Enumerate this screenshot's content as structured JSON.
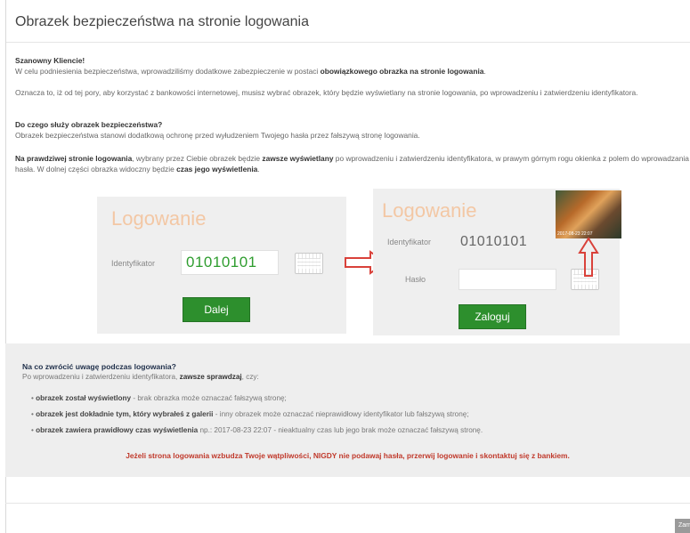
{
  "modal": {
    "title": "Obrazek bezpieczeństwa na stronie logowania",
    "greeting": "Szanowny Kliencie!",
    "intro_prefix": "W celu podniesienia bezpieczeństwa, wprowadziliśmy dodatkowe zabezpieczenie w postaci ",
    "intro_bold": "obowiązkowego obrazka na stronie logowania",
    "intro_suffix": ".",
    "paragraph2": "Oznacza to, iż od tej pory, aby korzystać z bankowości internetowej, musisz wybrać obrazek, który będzie wyświetlany na stronie logowania, po wprowadzeniu i zatwierdzeniu identyfikatora.",
    "question": "Do czego służy obrazek bezpieczeństwa?",
    "answer": "Obrazek bezpieczeństwa stanowi dodatkową ochronę przed wyłudzeniem Twojego hasła przez fałszywą stronę logowania.",
    "p4_bold1": "Na prawdziwej stronie logowania",
    "p4_text1": ", wybrany przez Ciebie obrazek będzie ",
    "p4_bold2": "zawsze wyświetlany",
    "p4_text2": " po wprowadzeniu i zatwierdzeniu identyfikatora, w prawym górnym rogu okienka z polem do wprowadzania hasła. W dolnej części obrazka widoczny będzie ",
    "p4_bold3": "czas jego wyświetlenia",
    "p4_text3": "."
  },
  "login1": {
    "title": "Logowanie",
    "id_label": "Identyfikator",
    "id_value": "01010101",
    "button": "Dalej"
  },
  "login2": {
    "title": "Logowanie",
    "id_label": "Identyfikator",
    "id_value": "01010101",
    "password_label": "Hasło",
    "button": "Zaloguj",
    "image_timestamp": "2017-08-23 22:07"
  },
  "tips": {
    "heading": "Na co zwrócić uwagę podczas logowania?",
    "sub_prefix": "Po wprowadzeniu i zatwierdzeniu identyfikatora, ",
    "sub_bold": "zawsze sprawdzaj",
    "sub_suffix": ", czy:",
    "b1_bold": "obrazek został wyświetlony",
    "b1_text": " - brak obrazka może oznaczać fałszywą stronę;",
    "b2_bold": "obrazek jest dokładnie tym, który wybrałeś z galerii",
    "b2_text": " - inny obrazek może oznaczać nieprawidłowy identyfikator lub fałszywą stronę;",
    "b3_bold": "obrazek zawiera prawidłowy czas wyświetlenia",
    "b3_text": " np.: 2017-08-23 22:07 - nieaktualny czas lub jego brak może oznaczać fałszywą stronę.",
    "warning": "Jeżeli strona logowania wzbudza Twoje wątpliwości, NIGDY nie podawaj hasła, przerwij logowanie i skontaktuj się z bankiem."
  },
  "footer": {
    "close_label": "Zamknij"
  },
  "colors": {
    "accent_green": "#2d8f2d",
    "warning_red": "#c0392b",
    "arrow_red": "#d9413a"
  }
}
